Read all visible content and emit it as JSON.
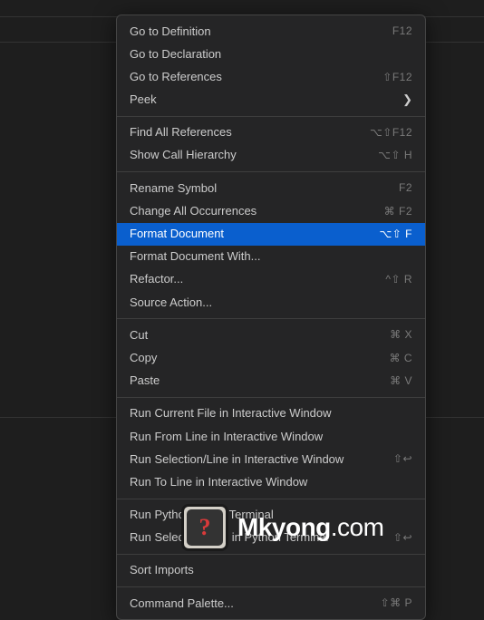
{
  "menu": {
    "groups": [
      [
        {
          "label": "Go to Definition",
          "shortcut": "F12"
        },
        {
          "label": "Go to Declaration"
        },
        {
          "label": "Go to References",
          "shortcut": "⇧F12"
        },
        {
          "label": "Peek",
          "submenu": true
        }
      ],
      [
        {
          "label": "Find All References",
          "shortcut": "⌥⇧F12"
        },
        {
          "label": "Show Call Hierarchy",
          "shortcut": "⌥⇧ H"
        }
      ],
      [
        {
          "label": "Rename Symbol",
          "shortcut": "F2"
        },
        {
          "label": "Change All Occurrences",
          "shortcut": "⌘ F2"
        },
        {
          "label": "Format Document",
          "shortcut": "⌥⇧ F",
          "highlighted": true
        },
        {
          "label": "Format Document With..."
        },
        {
          "label": "Refactor...",
          "shortcut": "^⇧ R"
        },
        {
          "label": "Source Action..."
        }
      ],
      [
        {
          "label": "Cut",
          "shortcut": "⌘ X"
        },
        {
          "label": "Copy",
          "shortcut": "⌘ C"
        },
        {
          "label": "Paste",
          "shortcut": "⌘ V"
        }
      ],
      [
        {
          "label": "Run Current File in Interactive Window"
        },
        {
          "label": "Run From Line in Interactive Window"
        },
        {
          "label": "Run Selection/Line in Interactive Window",
          "shortcut": "⇧↩"
        },
        {
          "label": "Run To Line in Interactive Window"
        }
      ],
      [
        {
          "label": "Run Python File in Terminal"
        },
        {
          "label": "Run Selection/Line in Python Terminal",
          "shortcut": "⇧↩"
        }
      ],
      [
        {
          "label": "Sort Imports"
        }
      ],
      [
        {
          "label": "Command Palette...",
          "shortcut": "⇧⌘ P"
        }
      ]
    ]
  },
  "watermark": {
    "icon_char": "?",
    "text_bold": "Mkyong",
    "text_thin": ".com"
  }
}
